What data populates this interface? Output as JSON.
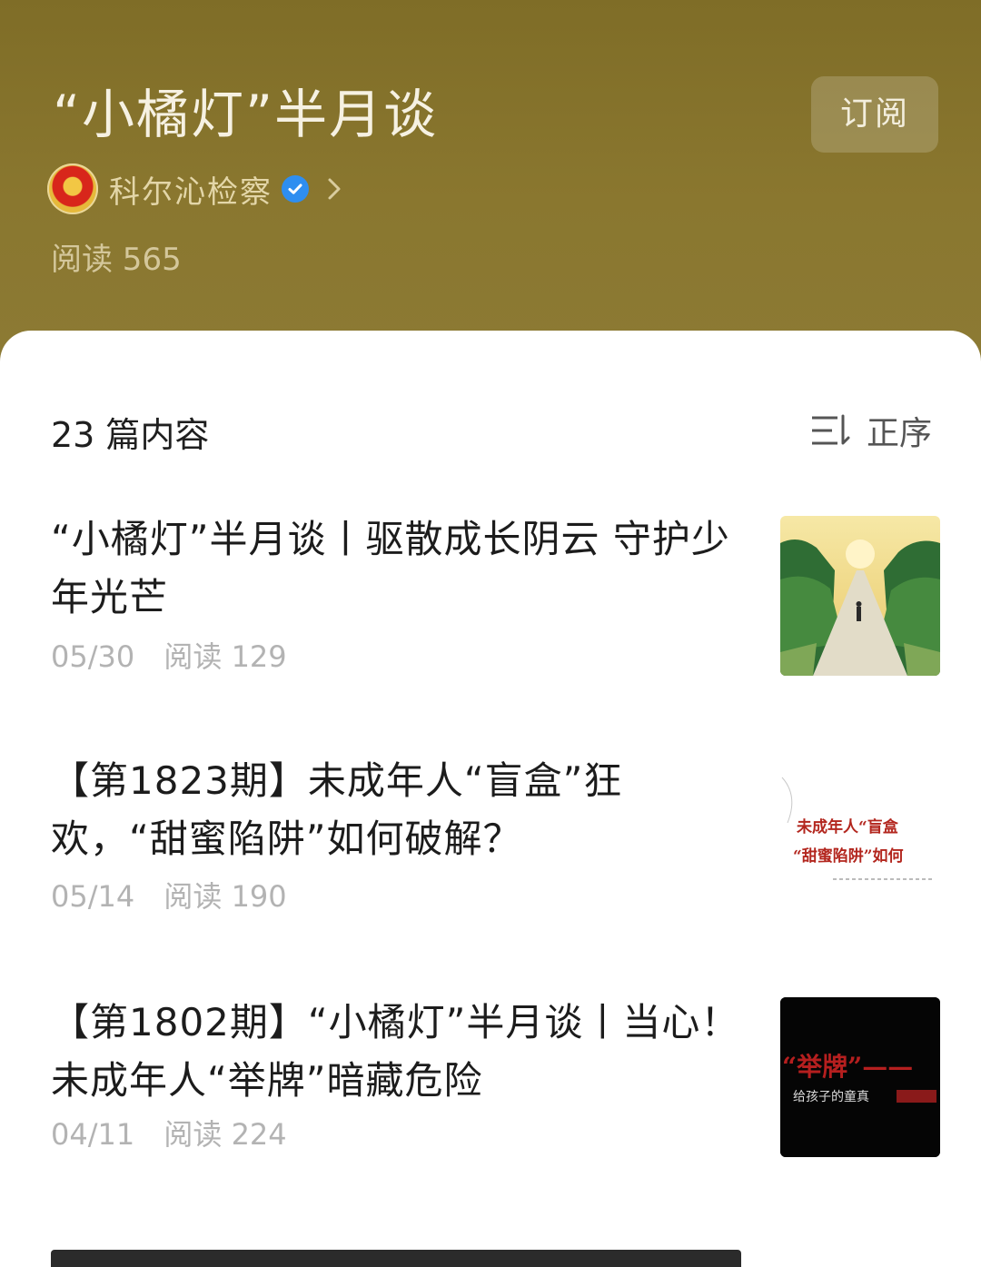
{
  "header": {
    "title": "“小橘灯”半月谈",
    "subscribe_label": "订阅",
    "author": "科尔沁检察",
    "reads_total": "阅读 565"
  },
  "list": {
    "count_label": "23 篇内容",
    "sort_label": "正序",
    "articles": [
      {
        "title": "“小橘灯”半月谈丨驱散成长阴云 守护少年光芒",
        "date": "05/30",
        "reads": "阅读 129"
      },
      {
        "title": "【第1823期】未成年人“盲盒”狂欢，“甜蜜陷阱”如何破解？",
        "date": "05/14",
        "reads": "阅读 190"
      },
      {
        "title": "【第1802期】“小橘灯”半月谈丨当心！未成年人“举牌”暗藏危险",
        "date": "04/11",
        "reads": "阅读 224"
      }
    ]
  },
  "thumbnails": {
    "t2_line1": "未成年人“盲盒",
    "t2_line2": "“甜蜜陷阱”如何",
    "t3_title": "“举牌”——",
    "t3_sub": "给孩子的童真"
  },
  "icons": [
    "avatar",
    "verified-icon",
    "chevron-right-icon",
    "sort-icon"
  ]
}
